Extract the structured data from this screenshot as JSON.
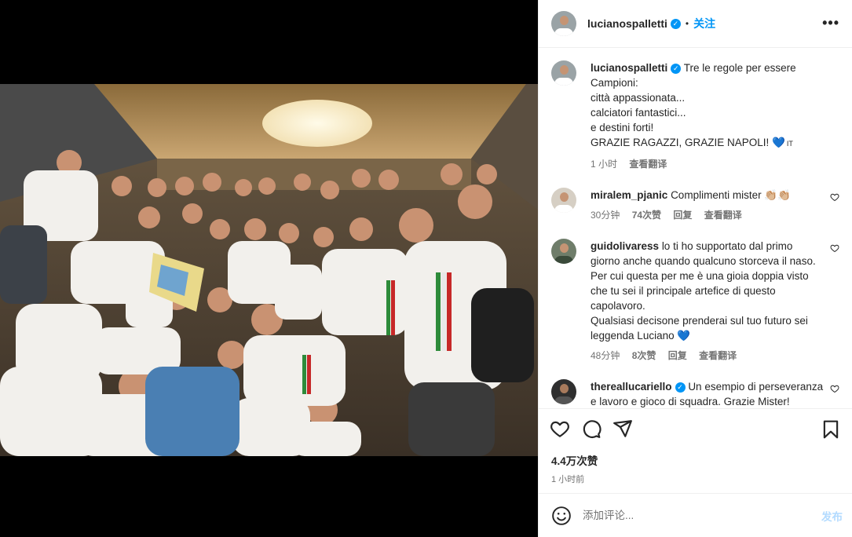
{
  "post": {
    "author": "lucianospalletti",
    "follow_label": "关注",
    "more_label": "•••",
    "separator": "•"
  },
  "caption": {
    "author": "lucianospalletti",
    "lines": [
      "Tre le regole per essere",
      "Campioni:",
      "città appassionata...",
      "calciatori fantastici...",
      "e destini forti!",
      "GRAZIE RAGAZZI, GRAZIE NAPOLI! 💙",
      "IT"
    ],
    "time": "1 小时",
    "translate": "查看翻译"
  },
  "comments": [
    {
      "author": "miralem_pjanic",
      "text": "Complimenti mister 👏🏼👏🏼",
      "time": "30分钟",
      "likes": "74次赞",
      "reply": "回复",
      "translate": "查看翻译"
    },
    {
      "author": "guidolivaress",
      "lines": [
        "lo ti ho supportato dal primo",
        "giorno anche quando qualcuno storceva il naso.",
        "Per cui questa per me è una gioia doppia visto",
        "che tu sei il principale artefice di questo",
        "capolavoro.",
        "Qualsiasi decisone prenderai sul tuo futuro sei",
        "leggenda Luciano 💙"
      ],
      "time": "48分钟",
      "likes": "8次赞",
      "reply": "回复",
      "translate": "查看翻译"
    },
    {
      "author": "thereallucariello",
      "lines": [
        "Un esempio di perseveranza",
        "e lavoro e gioco di squadra. Grazie Mister!"
      ]
    }
  ],
  "likes": {
    "count": "4.4万次赞",
    "time": "1 小时前"
  },
  "composer": {
    "placeholder": "添加评论...",
    "post_label": "发布"
  },
  "colors": {
    "accent": "#0095f6",
    "post_disabled": "#b3dbff",
    "muted": "#737373"
  }
}
